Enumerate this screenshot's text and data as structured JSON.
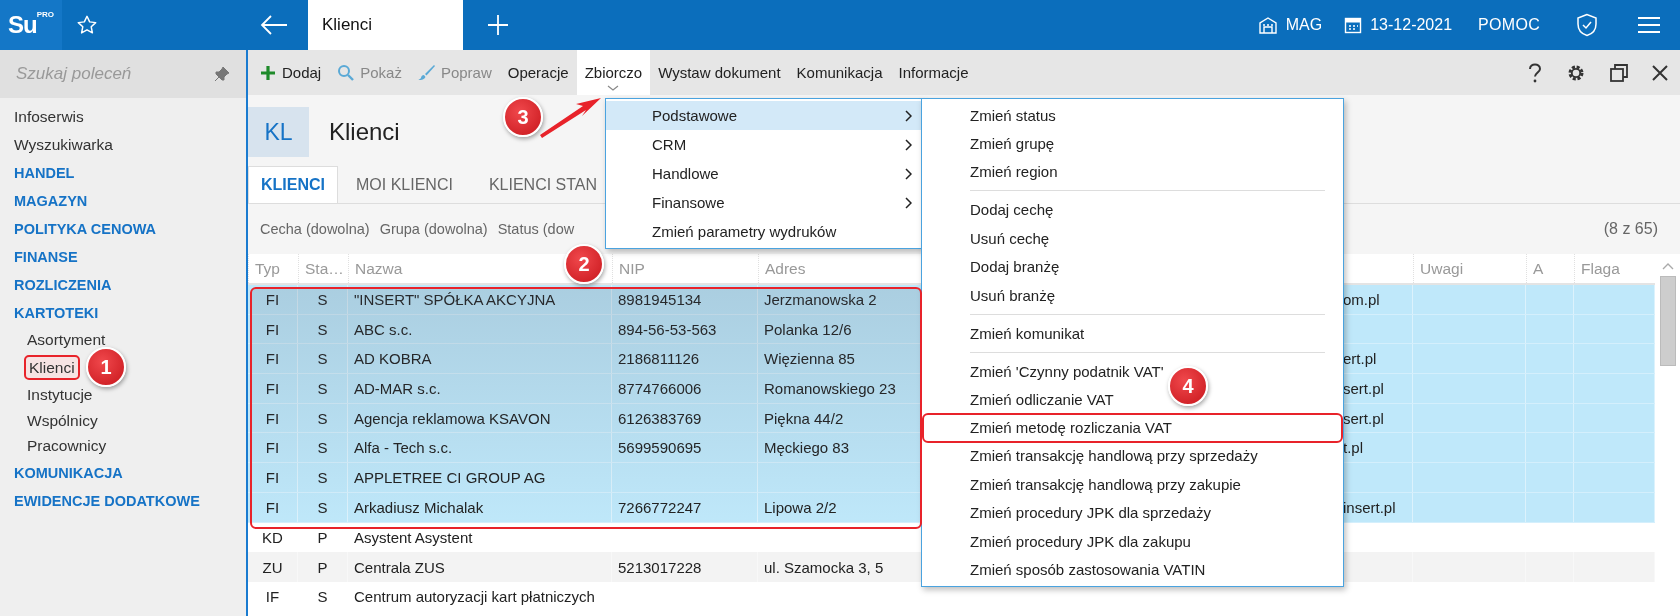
{
  "logo": {
    "text": "Su",
    "badge": "PRO"
  },
  "topbar": {
    "tab": "Klienci",
    "store": "MAG",
    "date": "13-12-2021",
    "help": "POMOC"
  },
  "sidebar": {
    "search": {
      "placeholder": "Szukaj poleceń"
    },
    "items": [
      {
        "label": "Infoserwis",
        "kind": "link"
      },
      {
        "label": "Wyszukiwarka",
        "kind": "link"
      },
      {
        "label": "HANDEL",
        "kind": "section"
      },
      {
        "label": "MAGAZYN",
        "kind": "section"
      },
      {
        "label": "POLITYKA CENOWA",
        "kind": "section"
      },
      {
        "label": "FINANSE",
        "kind": "section"
      },
      {
        "label": "ROZLICZENIA",
        "kind": "section"
      },
      {
        "label": "KARTOTEKI",
        "kind": "section",
        "children": [
          {
            "label": "Asortyment",
            "marked": false
          },
          {
            "label": "Klienci",
            "marked": true
          },
          {
            "label": "Instytucje",
            "marked": false
          },
          {
            "label": "Wspólnicy",
            "marked": false
          },
          {
            "label": "Pracownicy",
            "marked": false
          }
        ]
      },
      {
        "label": "KOMUNIKACJA",
        "kind": "section"
      },
      {
        "label": "EWIDENCJE DODATKOWE",
        "kind": "section"
      }
    ]
  },
  "toolbar": {
    "buttons": [
      {
        "label": "Dodaj",
        "kind": "add",
        "disabled": false,
        "selected": false
      },
      {
        "label": "Pokaż",
        "kind": "view",
        "disabled": true,
        "selected": false
      },
      {
        "label": "Popraw",
        "kind": "edit",
        "disabled": true,
        "selected": false
      },
      {
        "label": "Operacje",
        "kind": "menu",
        "disabled": false,
        "selected": false
      },
      {
        "label": "Zbiorczo",
        "kind": "menu",
        "disabled": false,
        "selected": true
      },
      {
        "label": "Wystaw dokument",
        "kind": "menu",
        "disabled": false,
        "selected": false
      },
      {
        "label": "Komunikacja",
        "kind": "menu",
        "disabled": false,
        "selected": false
      },
      {
        "label": "Informacje",
        "kind": "menu",
        "disabled": false,
        "selected": false
      }
    ]
  },
  "page": {
    "badge": "KL",
    "title": "Klienci"
  },
  "tabs": [
    {
      "label": "KLIENCI",
      "selected": true
    },
    {
      "label": "MOI KLIENCI",
      "selected": false
    },
    {
      "label": "KLIENCI STAN",
      "selected": false
    }
  ],
  "filters": [
    "Cecha (dowolna)",
    "Grupa (dowolna)",
    "Status (dow"
  ],
  "count": "(8 z 65)",
  "table": {
    "columns": [
      "Typ",
      "Sta…",
      "Nazwa",
      "NIP",
      "Adres",
      "",
      "Uwagi",
      "A",
      "Flaga"
    ],
    "rows": [
      {
        "cells": [
          "FI",
          "S",
          "\"INSERT\" SPÓŁKA AKCYJNA",
          "8981945134",
          "Jerzmanowska 2",
          "om.pl"
        ],
        "selected": true
      },
      {
        "cells": [
          "FI",
          "S",
          "ABC s.c.",
          "894-56-53-563",
          "Polanka  12/6",
          ""
        ],
        "selected": true
      },
      {
        "cells": [
          "FI",
          "S",
          "AD KOBRA",
          "2186811126",
          "Więzienna  85",
          "ert.pl"
        ],
        "selected": true
      },
      {
        "cells": [
          "FI",
          "S",
          "AD-MAR s.c.",
          "8774766006",
          "Romanowskiego 23",
          "sert.pl"
        ],
        "selected": true
      },
      {
        "cells": [
          "FI",
          "S",
          "Agencja reklamowa KSAVON",
          "6126383769",
          "Piękna  44/2",
          "sert.pl"
        ],
        "selected": true
      },
      {
        "cells": [
          "FI",
          "S",
          "Alfa - Tech s.c.",
          "5699590695",
          "Męckiego  83",
          "t.pl"
        ],
        "selected": true
      },
      {
        "cells": [
          "FI",
          "S",
          "APPLETREE CI GROUP AG",
          "",
          "",
          ""
        ],
        "selected": true
      },
      {
        "cells": [
          "FI",
          "S",
          "Arkadiusz Michalak",
          "7266772247",
          "Lipowa  2/2",
          "insert.pl"
        ],
        "selected": true
      },
      {
        "cells": [
          "KD",
          "P",
          "Asystent Asystent",
          "",
          "",
          ""
        ],
        "selected": false
      },
      {
        "cells": [
          "ZU",
          "P",
          "Centrala ZUS",
          "5213017228",
          "ul. Szamocka 3, 5",
          ""
        ],
        "selected": false
      },
      {
        "cells": [
          "IF",
          "S",
          "Centrum autoryzacji kart płatniczych",
          "",
          "",
          ""
        ],
        "selected": false
      }
    ]
  },
  "menu": {
    "items": [
      {
        "label": "Podstawowe",
        "has_submenu": true,
        "selected": true
      },
      {
        "label": "CRM",
        "has_submenu": true,
        "selected": false
      },
      {
        "label": "Handlowe",
        "has_submenu": true,
        "selected": false
      },
      {
        "label": "Finansowe",
        "has_submenu": true,
        "selected": false
      },
      {
        "label": "Zmień parametry wydruków",
        "has_submenu": false,
        "selected": false
      }
    ]
  },
  "submenu": {
    "groups": [
      {
        "items": [
          {
            "label": "Zmień status",
            "marked": false
          },
          {
            "label": "Zmień grupę",
            "marked": false
          },
          {
            "label": "Zmień region",
            "marked": false
          }
        ]
      },
      {
        "items": [
          {
            "label": "Dodaj cechę",
            "marked": false
          },
          {
            "label": "Usuń cechę",
            "marked": false
          },
          {
            "label": "Dodaj branżę",
            "marked": false
          },
          {
            "label": "Usuń branżę",
            "marked": false
          }
        ]
      },
      {
        "items": [
          {
            "label": "Zmień komunikat",
            "marked": false
          }
        ]
      },
      {
        "items": [
          {
            "label": "Zmień 'Czynny podatnik VAT'",
            "marked": false
          },
          {
            "label": "Zmień odliczanie VAT",
            "marked": false
          },
          {
            "label": "Zmień metodę rozliczania VAT",
            "marked": true
          },
          {
            "label": "Zmień transakcję handlową przy sprzedaży",
            "marked": false
          },
          {
            "label": "Zmień transakcję handlową przy zakupie",
            "marked": false
          },
          {
            "label": "Zmień procedury JPK dla sprzedaży",
            "marked": false
          },
          {
            "label": "Zmień procedury JPK dla zakupu",
            "marked": false
          },
          {
            "label": "Zmień sposób zastosowania VATIN",
            "marked": false
          }
        ]
      }
    ]
  },
  "annotations": [
    {
      "number": "1"
    },
    {
      "number": "2"
    },
    {
      "number": "3"
    },
    {
      "number": "4"
    }
  ]
}
